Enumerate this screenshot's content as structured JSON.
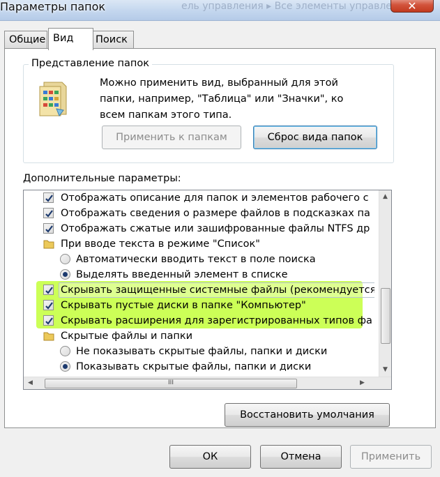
{
  "window": {
    "title": "Параметры папок",
    "title_ghost": "ель управления ▸ Все элементы управле",
    "close_glyph": "✕"
  },
  "tabs": [
    {
      "label": "Общие",
      "active": false
    },
    {
      "label": "Вид",
      "active": true
    },
    {
      "label": "Поиск",
      "active": false
    }
  ],
  "folder_views": {
    "legend": "Представление папок",
    "desc_lines": [
      "Можно применить вид, выбранный для этой",
      "папки, например, \"Таблица\" или \"Значки\", ко",
      "всем папкам этого типа."
    ],
    "apply_label": "Применить к папкам",
    "reset_label": "Сброс вида папок"
  },
  "advanced": {
    "label": "Дополнительные параметры:",
    "items": [
      {
        "kind": "check",
        "checked": true,
        "text": "Отображать описание для папок и элементов рабочего с"
      },
      {
        "kind": "check",
        "checked": true,
        "text": "Отображать сведения о размере файлов в подсказках па"
      },
      {
        "kind": "check",
        "checked": true,
        "text": "Отображать сжатые или зашифрованные файлы NTFS др"
      },
      {
        "kind": "folder",
        "text": "При вводе текста в режиме \"Список\""
      },
      {
        "kind": "radio",
        "checked": false,
        "text": "Автоматически вводить текст в поле поиска"
      },
      {
        "kind": "radio",
        "checked": true,
        "text": "Выделять введенный элемент в списке"
      },
      {
        "kind": "check",
        "checked": true,
        "text": "Скрывать защищенные системные файлы (рекомендуется)"
      },
      {
        "kind": "check",
        "checked": true,
        "text": "Скрывать пустые диски в папке \"Компьютер\""
      },
      {
        "kind": "check",
        "checked": true,
        "text": "Скрывать расширения для зарегистрированных типов фа"
      },
      {
        "kind": "folder",
        "text": "Скрытые файлы и папки"
      },
      {
        "kind": "radio",
        "checked": false,
        "text": "Не показывать скрытые файлы, папки и диски"
      },
      {
        "kind": "radio",
        "checked": true,
        "text": "Показывать скрытые файлы, папки и диски"
      }
    ],
    "hthumb_grip": "III",
    "restore_label": "Восстановить умолчания"
  },
  "dialog_buttons": {
    "ok": "ОК",
    "cancel": "Отмена",
    "apply": "Применить"
  },
  "colors": {
    "highlight": "#c8ff3c",
    "checkmark": "#1c3a6e"
  }
}
